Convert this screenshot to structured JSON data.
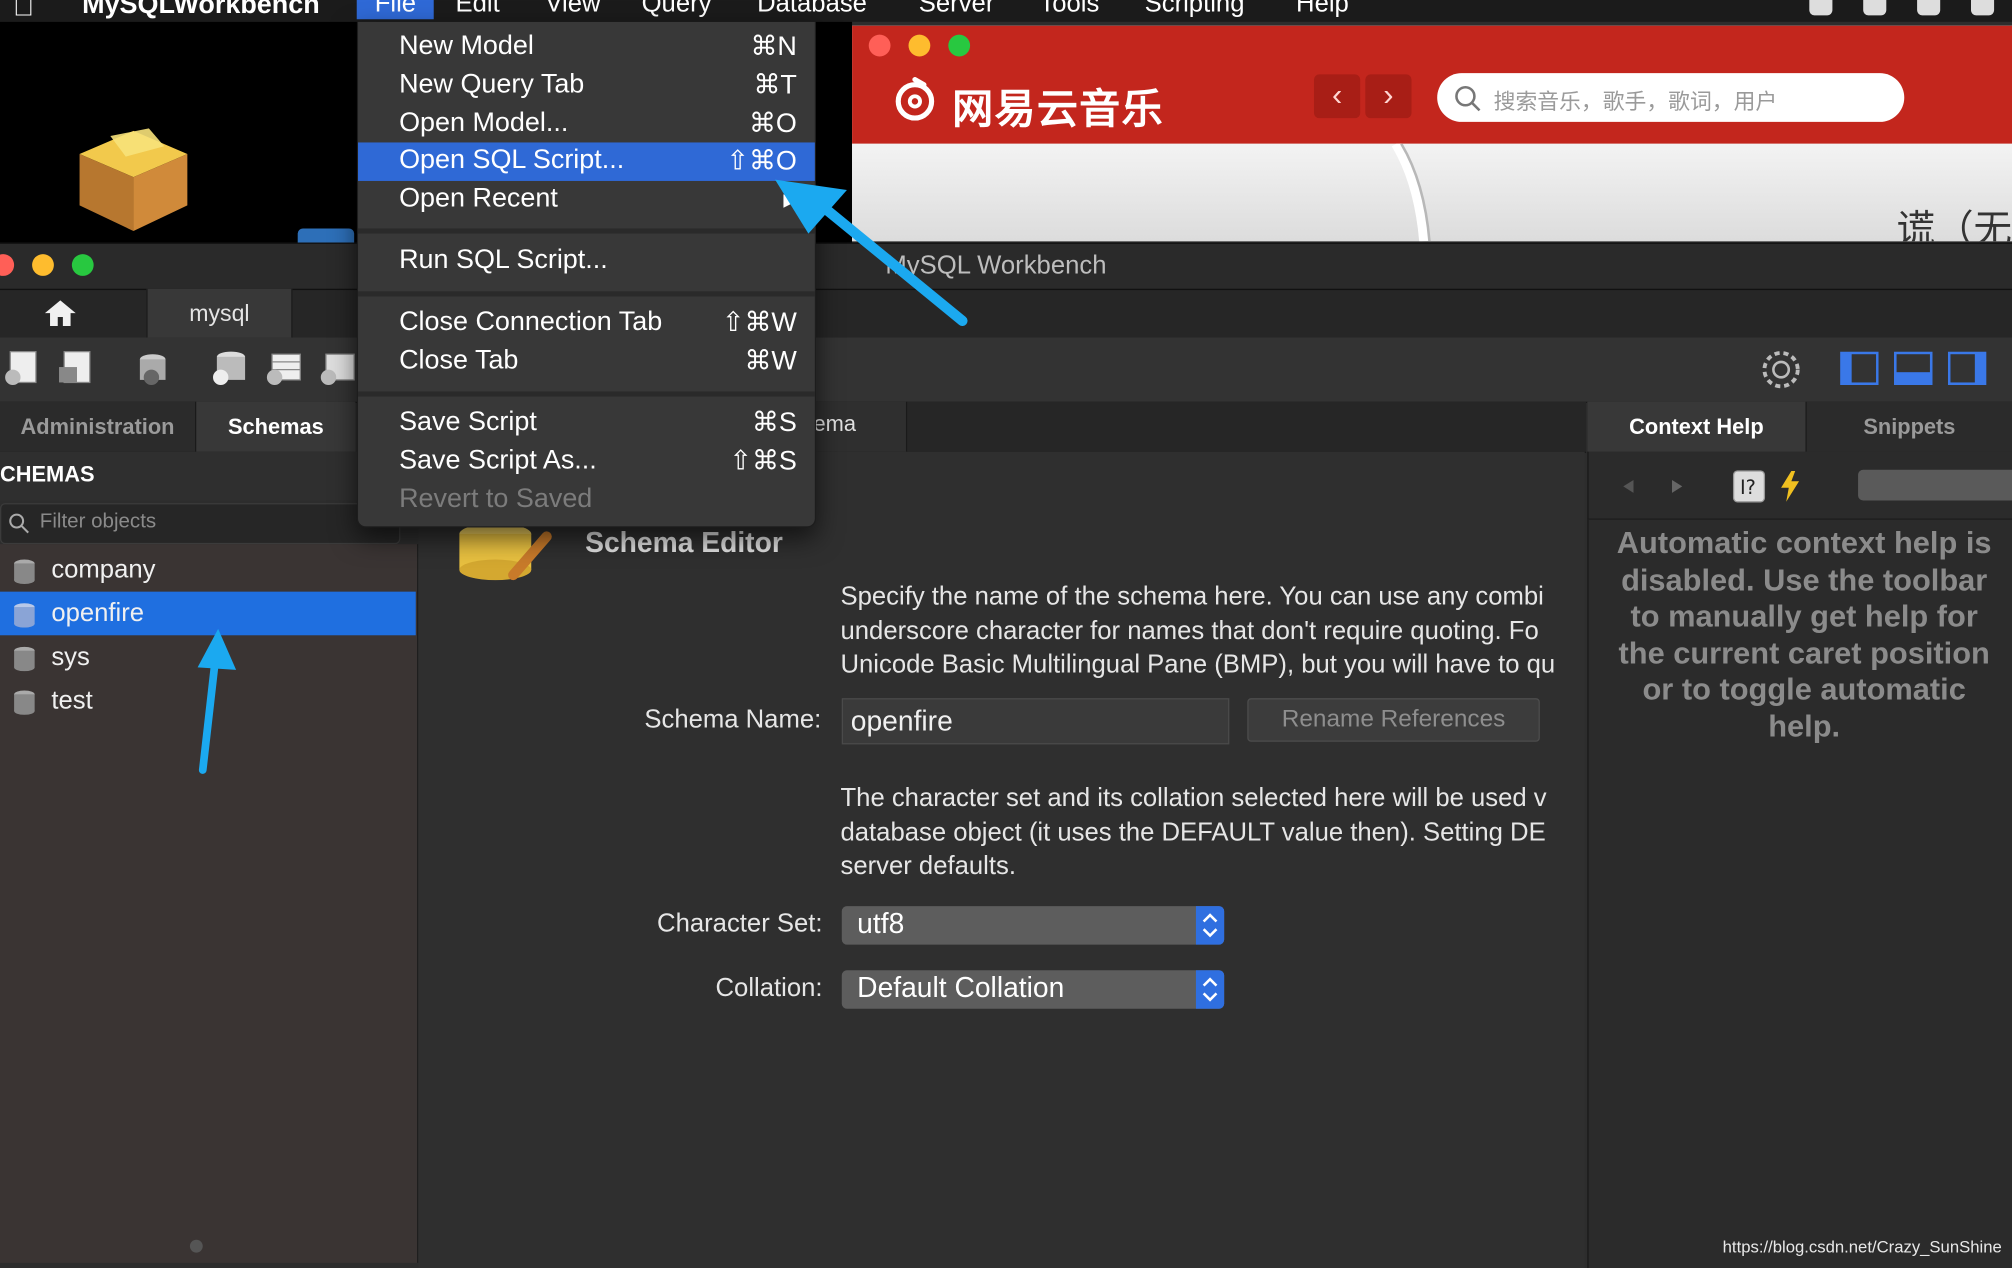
{
  "menubar": {
    "app_name": "MySQLWorkbench",
    "items": [
      "File",
      "Edit",
      "View",
      "Query",
      "Database",
      "Server",
      "Tools",
      "Scripting",
      "Help"
    ]
  },
  "file_menu": {
    "items": [
      {
        "label": "New Model",
        "shortcut": "⌘N"
      },
      {
        "label": "New Query Tab",
        "shortcut": "⌘T"
      },
      {
        "label": "Open Model...",
        "shortcut": "⌘O"
      },
      {
        "label": "Open SQL Script...",
        "shortcut": "⇧⌘O"
      },
      {
        "label": "Open Recent",
        "shortcut": "▸"
      },
      {
        "label": "Run SQL Script...",
        "shortcut": ""
      },
      {
        "label": "Close Connection Tab",
        "shortcut": "⇧⌘W"
      },
      {
        "label": "Close Tab",
        "shortcut": "⌘W"
      },
      {
        "label": "Save Script",
        "shortcut": "⌘S"
      },
      {
        "label": "Save Script As...",
        "shortcut": "⇧⌘S"
      },
      {
        "label": "Revert to Saved",
        "shortcut": ""
      }
    ]
  },
  "netease": {
    "logo": "网易云音乐",
    "search_placeholder": "搜索音乐，歌手，歌词，用户",
    "nav_back": "‹",
    "nav_forward": "›",
    "partial_title": "谎（无"
  },
  "workbench": {
    "window_title": "MySQL Workbench",
    "connection_tab": "mysql",
    "sidebar_tabs": [
      "Administration",
      "Schemas"
    ],
    "schemas_header": "CHEMAS",
    "filter_placeholder": "Filter objects",
    "schemas": [
      "company",
      "openfire",
      "sys",
      "test"
    ],
    "editor_tab": "ema",
    "editor": {
      "title": "Schema Editor",
      "intro_lines": [
        "Specify the name of the schema here. You can use any combi",
        "underscore character for names that don't require quoting. Fo",
        "Unicode Basic Multilingual Pane (BMP), but you will have to qu"
      ],
      "schema_name_label": "Schema Name:",
      "schema_name_value": "openfire",
      "rename_button": "Rename References",
      "charset_lines": [
        "The character set and its collation selected here will be used v",
        "database object (it uses the DEFAULT value then). Setting DE",
        "server defaults."
      ],
      "charset_label": "Character Set:",
      "charset_value": "utf8",
      "collation_label": "Collation:",
      "collation_value": "Default Collation"
    },
    "right_tabs": [
      "Context Help",
      "Snippets"
    ],
    "context_help_lines": [
      "Automatic context help is",
      "disabled. Use the toolbar",
      "to manually get help for",
      "the current caret position",
      "or to toggle automatic",
      "help."
    ]
  },
  "watermark": "https://blog.csdn.net/Crazy_SunShine",
  "colors": {
    "selection_blue": "#2f69d6",
    "netease_red": "#c3261d",
    "arrow_cyan": "#1ba9f0"
  }
}
